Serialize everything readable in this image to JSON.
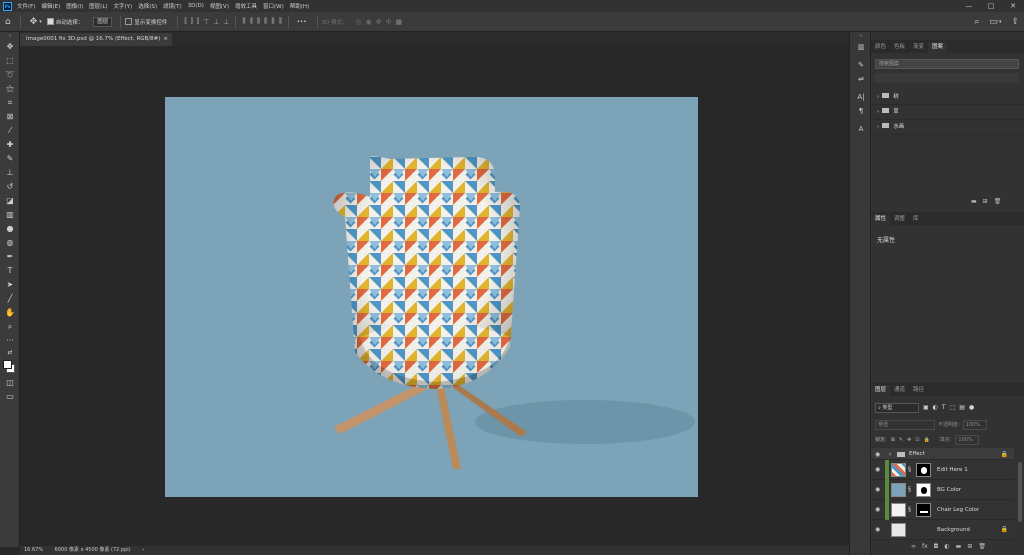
{
  "menubar": {
    "logo": "Ps",
    "items": [
      "文件(F)",
      "编辑(E)",
      "图像(I)",
      "图层(L)",
      "文字(Y)",
      "选择(S)",
      "滤镜(T)",
      "3D(D)",
      "视图(V)",
      "增效工具",
      "窗口(W)",
      "帮助(H)"
    ],
    "window_controls": [
      "—",
      "□",
      "✕"
    ]
  },
  "optbar": {
    "auto_select_label": "自动选择：",
    "auto_select_value": "图层",
    "show_transform_label": "显示变换控件",
    "more": "•••",
    "mode_3d_label": "3D 模式：",
    "icons": [
      "home-icon",
      "move-icon",
      "align-icons",
      "search-icon",
      "workspace-icon",
      "share-icon"
    ]
  },
  "document": {
    "tab_title": "Image0001 fix 3D.psd @ 16.7% (Effect, RGB/8#)",
    "close": "×"
  },
  "status": {
    "zoom": "16.67%",
    "dims": "6000 像素 x 4500 像素 (72 ppi)",
    "arrow": "›"
  },
  "top_panel": {
    "tabs": [
      "颜色",
      "色板",
      "渐变",
      "图案"
    ],
    "active_tab": "图案",
    "search_placeholder": "搜索图案",
    "folders": [
      "树",
      "草",
      "水画"
    ]
  },
  "props_panel": {
    "tabs": [
      "属性",
      "调整",
      "库"
    ],
    "active_tab": "属性",
    "text": "无属性"
  },
  "layers_panel": {
    "tabs": [
      "图层",
      "通道",
      "路径"
    ],
    "active_tab": "图层",
    "filter_label": "类型",
    "blend_mode": "穿透",
    "opacity_label": "不透明度:",
    "opacity_value": "100%",
    "lock_label": "锁定:",
    "fill_label": "填充:",
    "fill_value": "100%",
    "layers": [
      {
        "name": "Effect",
        "type": "group",
        "locked": true
      },
      {
        "name": "Edit Here 1",
        "type": "smart",
        "selected": false
      },
      {
        "name": "BG Color",
        "type": "adjust"
      },
      {
        "name": "Chair Leg Color",
        "type": "adjust"
      },
      {
        "name": "Background",
        "type": "bg",
        "locked": true
      }
    ],
    "footer_icons": [
      "link-icon",
      "fx-icon",
      "mask-icon",
      "adjust-icon",
      "group-icon",
      "new-layer-icon",
      "delete-icon"
    ]
  },
  "colors": {
    "canvas_bg": "#7ca3b7",
    "chair_red": "#e06a44",
    "chair_blue": "#4f97c7",
    "chair_yellow": "#e3b52f",
    "wood": "#b98a5a"
  }
}
